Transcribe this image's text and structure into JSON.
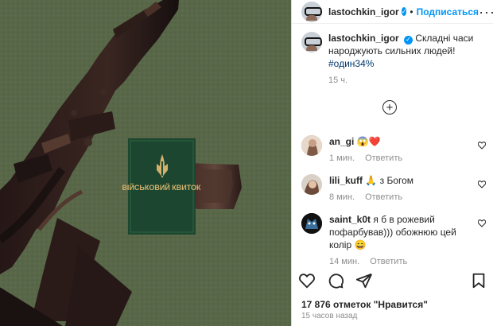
{
  "post": {
    "username": "lastochkin_igor",
    "follow_label": "Подписаться",
    "dot": "•",
    "more_label": "···",
    "caption_text": "Складні часи народжують сильних людей!",
    "hashtag": "#один34%",
    "caption_time": "15 ч.",
    "likes": "17 876 отметок \"Нравится\"",
    "posted": "15 часов назад"
  },
  "photo": {
    "military_id_title": "ВІЙСЬКОВИЙ КВИТОК",
    "icons": [
      "gun-icon",
      "document-icon",
      "trident-icon"
    ],
    "colors": {
      "carpet": "#5f6d52",
      "gun": "#211716",
      "booklet": "#1d4a31"
    }
  },
  "comments": [
    {
      "username": "an_gi",
      "text": "😱❤️",
      "time": "1 мин.",
      "reply": "Ответить"
    },
    {
      "username": "lili_kuff",
      "text": "🙏 з Богом",
      "time": "8 мин.",
      "reply": "Ответить"
    },
    {
      "username": "saint_k0t",
      "text": "я б в рожевий пофарбував))) обожнюю цей колір 😄",
      "time": "14 мин.",
      "reply": "Ответить"
    }
  ],
  "actions": {
    "icons": [
      "heart-icon",
      "comment-icon",
      "share-icon",
      "bookmark-icon",
      "plus-circle-icon"
    ],
    "accent": "#0095f6"
  }
}
